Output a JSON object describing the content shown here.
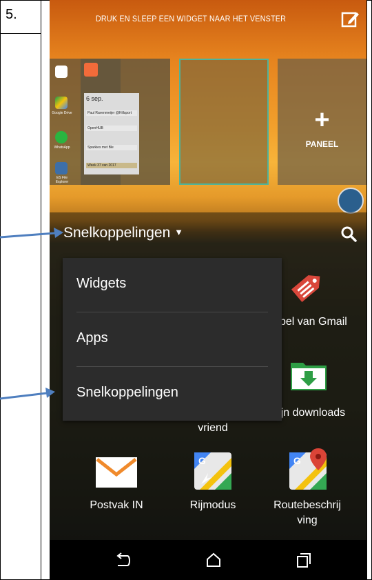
{
  "document": {
    "step_number": "5."
  },
  "screen": {
    "topbar_hint": "DRUK EN SLEEP EEN WIDGET NAAR HET VENSTER",
    "panels": {
      "add_panel_symbol": "+",
      "add_panel_label": "PANEEL",
      "mini_app_labels": [
        "Google Drive",
        "WhatsApp",
        "ES File Explorer"
      ],
      "calendar_widget": {
        "day": "6 sep.",
        "rows": [
          "Paul Ravenmeijer @Hillsport",
          "OpenHUB",
          "Sparkies met Ble",
          "Week 37 van 2017"
        ]
      }
    },
    "drawer": {
      "selector_label": "Snelkoppelingen",
      "dropdown_options": [
        "Widgets",
        "Apps",
        "Snelkoppelingen"
      ]
    },
    "apps": [
      {
        "label": "Label van Gmail",
        "icon": "gmail-label-icon"
      },
      {
        "label": "vriend",
        "icon": "contact-icon"
      },
      {
        "label": "Mijn downloads",
        "icon": "downloads-folder-icon"
      },
      {
        "label": "Postvak IN",
        "icon": "mail-envelope-icon"
      },
      {
        "label": "Rijmodus",
        "icon": "maps-driving-icon"
      },
      {
        "label": "Routebeschrij ving",
        "icon": "maps-directions-icon"
      }
    ],
    "colors": {
      "accent_arrow": "#4f7fbf",
      "selection_border": "#4fb39a",
      "gmail_red": "#d9473b"
    }
  }
}
